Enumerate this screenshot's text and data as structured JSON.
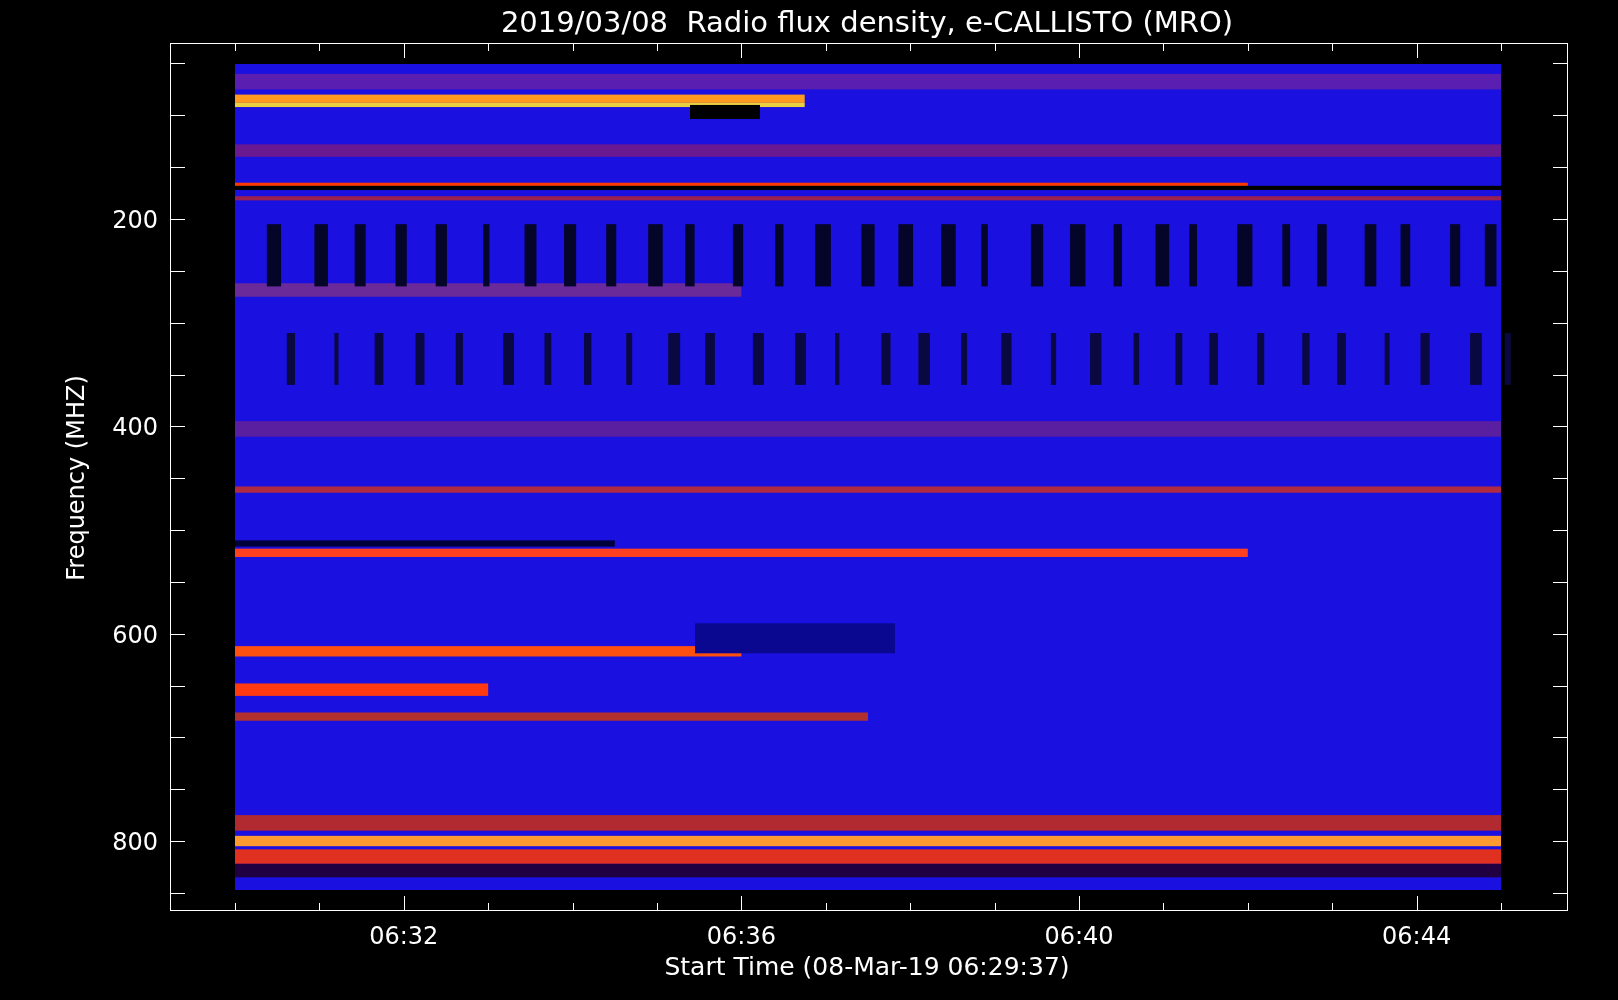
{
  "title": "2019/03/08  Radio flux density, e-CALLISTO (MRO)",
  "y_axis": {
    "label": "Frequency (MHZ)",
    "tick_labels": [
      "200",
      "400",
      "600",
      "800"
    ]
  },
  "x_axis": {
    "label": "Start Time (08-Mar-19 06:29:37)",
    "tick_labels": [
      "06:32",
      "06:36",
      "06:40",
      "06:44"
    ]
  }
}
